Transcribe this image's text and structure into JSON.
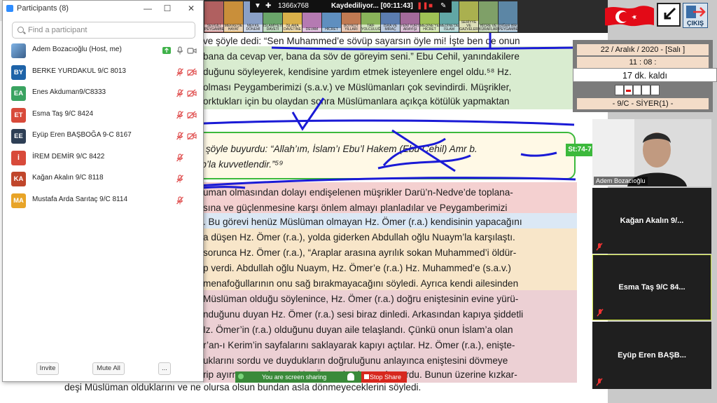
{
  "participants": {
    "window_title": "Participants (8)",
    "search_placeholder": "Find a participant",
    "list": [
      {
        "initials": "",
        "name": "Adem Bozacıoğlu (Host, me)",
        "color": "#5a7fa8",
        "muted": false,
        "video_off": false
      },
      {
        "initials": "BY",
        "name": "BERKE YURDAKUL 9/C 8013",
        "color": "#1e63a8",
        "muted": true,
        "video_off": true
      },
      {
        "initials": "EA",
        "name": "Enes Akduman9/C8333",
        "color": "#3aa361",
        "muted": true,
        "video_off": true
      },
      {
        "initials": "ET",
        "name": "Esma Taş 9/C 8424",
        "color": "#d84a3a",
        "muted": true,
        "video_off": true
      },
      {
        "initials": "EE",
        "name": "Eyüp Eren BAŞBOĞA 9-C 8167",
        "color": "#2e3f55",
        "muted": true,
        "video_off": true
      },
      {
        "initials": "İ",
        "name": "İREM DEMİR 9/C 8422",
        "color": "#d84a3a",
        "muted": true,
        "video_off": false
      },
      {
        "initials": "KA",
        "name": "Kağan Akalın 9/C 8118",
        "color": "#c0462b",
        "muted": true,
        "video_off": false
      },
      {
        "initials": "MA",
        "name": "Mustafa Arda Sarıtaç 9/C 8114",
        "color": "#e8a427",
        "muted": true,
        "video_off": false
      }
    ],
    "invite_label": "Invite",
    "mute_all_label": "Mute All",
    "more_label": "..."
  },
  "toolbar": {
    "resolution": "1366x768",
    "recording": "Kaydediliyor... [00:11:43]",
    "tiles": [
      {
        "label": "SEVGİLİ PEYGAMBERİM",
        "color": "#b06060"
      },
      {
        "label": "MEKKE'DE HAYAT",
        "color": "#c98f3a"
      },
      {
        "label": "MEKKE DÖNEMİ",
        "color": "#8aa0c6"
      },
      {
        "label": "İSLAMİYETİN DAVETİ",
        "color": "#6aa56a"
      },
      {
        "label": "İSLAMA DAVETİNE",
        "color": "#d9b04a"
      },
      {
        "label": "DEVAM",
        "color": "#b57ab2"
      },
      {
        "label": "HİCRET",
        "color": "#5f8fbf"
      },
      {
        "label": "BOYKOT YILLARI",
        "color": "#c07a52"
      },
      {
        "label": "TAİF YOLCULUĞU",
        "color": "#8ab35a"
      },
      {
        "label": "İSRA VE MİRAÇ",
        "color": "#5b7db0"
      },
      {
        "label": "YENİ YURT ARAYIŞI",
        "color": "#a36a9a"
      },
      {
        "label": "MEDİNE'YE HİCRET",
        "color": "#9fc255"
      },
      {
        "label": "MEDİNE'DE İSLAM",
        "color": "#61a7a5"
      },
      {
        "label": "SERİYYE VE GAZVELER",
        "color": "#aab04f"
      },
      {
        "label": "HİCRE VE KÜRAFLAR",
        "color": "#7fa068"
      },
      {
        "label": "DİĞER BİR PEYGAMBER",
        "color": "#5c86a5"
      }
    ]
  },
  "info_panel": {
    "date": "22 / Aralık / 2020 - [Salı ]",
    "time": "11 : 08 :",
    "remaining": "17 dk.  kaldı",
    "class_label": "- 9/C - SİYER(1) -"
  },
  "exit_label": "ÇIKIŞ",
  "gallery": {
    "host_name": "Adem Bozacıoğlu",
    "tiles": [
      "Kağan Akalın 9/...",
      "Esma Taş 9/C 84...",
      "Eyüp Eren BAŞB..."
    ]
  },
  "share_bar": {
    "status": "You are screen sharing",
    "stop": "Stop Share"
  },
  "document": {
    "lines_top": [
      "ve şöyle dedi: “Sen Muhammed’e sövüp sayarsın öyle mi! İşte ben de onun",
      "bana da cevap ver, bana da söv de göreyim seni.” Ebu Cehil, yanındakilere",
      "duğunu söyleyerek, kendisine yardım etmek isteyenlere engel oldu.⁵⁸ Hz.",
      "olması Peygamberimizi (s.a.v.) ve Müslümanları çok sevindirdi. Müşrikler,",
      "orktukları için bu olaydan sonra Müslümanlara açıkça kötülük yapmaktan"
    ],
    "quote_line1": "v.) şöyle buyurdu: “Allah’ım, İslam’ı Ebu’l Hakem (Ebu Cehil) Amr b.",
    "quote_line2": "tab’la kuvvetlendir.”⁵⁹",
    "quote_tag": "St:74-7",
    "lines_bottom": [
      "uman olmasından dolayı endişelenen müşrikler Darü’n-Nedve’de toplana-",
      "sına ve güçlenmesine karşı önlem almayı planladılar ve Peygamberimizi",
      ". Bu görevi henüz Müslüman olmayan Hz. Ömer (r.a.) kendisinin yapacağını",
      "a düşen Hz. Ömer (r.a.), yolda giderken Abdullah oğlu Nuaym’la karşılaştı.",
      "sorunca Hz. Ömer (r.a.), “Araplar arasına ayrılık sokan Muhammed’i öldür-",
      "p verdi. Abdullah oğlu Nuaym, Hz. Ömer’e (r.a.) Hz. Muhammed’e (s.a.v.)",
      "menafoğullarının onu sağ bırakmayacağını söyledi. Ayrıca kendi ailesinden",
      "Müslüman olduğu söylenince, Hz. Ömer (r.a.) doğru eniştesinin evine yürü-",
      "nduğunu duyan Hz. Ömer (r.a.) sesi biraz dinledi. Arkasından kapıya şiddetli",
      "Iz. Ömer’in (r.a.) olduğunu duyan aile telaşlandı. Çünkü onun İslam’a olan",
      "r’an-ı Kerim’in sayfalarını saklayarak kapıyı açtılar. Hz. Ömer (r.a.), enişte-",
      "uklarını sordu ve duydukların doğruluğunu anlayınca eniştesini dövmeye",
      "rip ayırmaya çalışınca Hz. Ömer (r.a.) ona da vurdu. Bunun üzerine kızkar-",
      "deşi Müslüman olduklarını ve ne olursa olsun bundan asla dönmeyeceklerini söyledi."
    ]
  }
}
